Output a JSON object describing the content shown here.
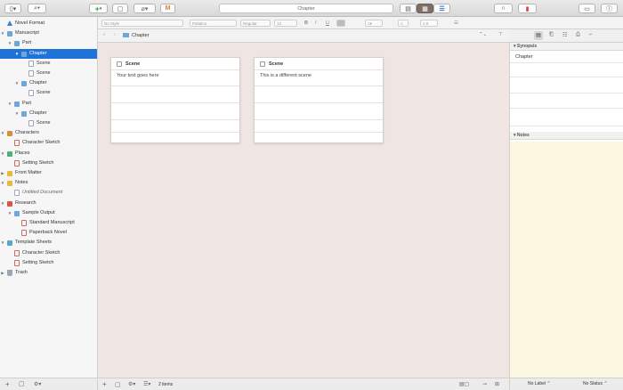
{
  "toolbar": {
    "title": "Chapter",
    "colors": {
      "selected_view": "#7d6f67",
      "accent": "#1f73d8"
    }
  },
  "formatbar": {
    "style": "No Style",
    "font": "Palatino",
    "weight": "Regular",
    "size": "12",
    "bold": "B",
    "italic": "I",
    "underline": "U",
    "line_spacing": "1.0"
  },
  "binder": {
    "items": [
      {
        "label": "Novel Format",
        "level": 0,
        "icon": "triangle-icon"
      },
      {
        "label": "Manuscript",
        "level": 0,
        "icon": "manuscript-icon"
      },
      {
        "label": "Part",
        "level": 1,
        "icon": "folder-icon"
      },
      {
        "label": "Chapter",
        "level": 2,
        "icon": "folder-icon",
        "selected": true
      },
      {
        "label": "Scene",
        "level": 3,
        "icon": "doc-icon"
      },
      {
        "label": "Scene",
        "level": 3,
        "icon": "doc-icon"
      },
      {
        "label": "Chapter",
        "level": 2,
        "icon": "folder-icon"
      },
      {
        "label": "Scene",
        "level": 3,
        "icon": "doc-icon"
      },
      {
        "label": "Part",
        "level": 1,
        "icon": "folder-icon"
      },
      {
        "label": "Chapter",
        "level": 2,
        "icon": "folder-icon"
      },
      {
        "label": "Scene",
        "level": 3,
        "icon": "doc-icon"
      },
      {
        "label": "Characters",
        "level": 0,
        "icon": "characters-folder-icon"
      },
      {
        "label": "Character Sketch",
        "level": 1,
        "icon": "character-sheet-icon"
      },
      {
        "label": "Places",
        "level": 0,
        "icon": "places-folder-icon"
      },
      {
        "label": "Setting Sketch",
        "level": 1,
        "icon": "setting-sheet-icon"
      },
      {
        "label": "Front Matter",
        "level": 0,
        "icon": "front-matter-folder-icon"
      },
      {
        "label": "Notes",
        "level": 0,
        "icon": "notes-folder-icon"
      },
      {
        "label": "Untitled Document",
        "level": 1,
        "icon": "doc-icon"
      },
      {
        "label": "Research",
        "level": 0,
        "icon": "research-folder-icon"
      },
      {
        "label": "Sample Output",
        "level": 1,
        "icon": "folder-icon"
      },
      {
        "label": "Standard Manuscript",
        "level": 2,
        "icon": "pdf-icon"
      },
      {
        "label": "Paperback Novel",
        "level": 2,
        "icon": "pdf-icon"
      },
      {
        "label": "Template Sheets",
        "level": 0,
        "icon": "template-folder-icon"
      },
      {
        "label": "Character Sketch",
        "level": 1,
        "icon": "character-sheet-icon"
      },
      {
        "label": "Setting Sketch",
        "level": 1,
        "icon": "setting-sheet-icon"
      },
      {
        "label": "Trash",
        "level": 0,
        "icon": "trash-icon"
      }
    ]
  },
  "editor": {
    "breadcrumb": "Chapter",
    "cards": [
      {
        "title": "Scene",
        "synopsis": "Your text goes here"
      },
      {
        "title": "Scene",
        "synopsis": "This is a different scene"
      }
    ],
    "item_count": "2 items"
  },
  "inspector": {
    "synopsis_header": "Synopsis",
    "synopsis_title": "Chapter",
    "notes_header": "Notes",
    "label_value": "No Label",
    "status_value": "No Status"
  }
}
